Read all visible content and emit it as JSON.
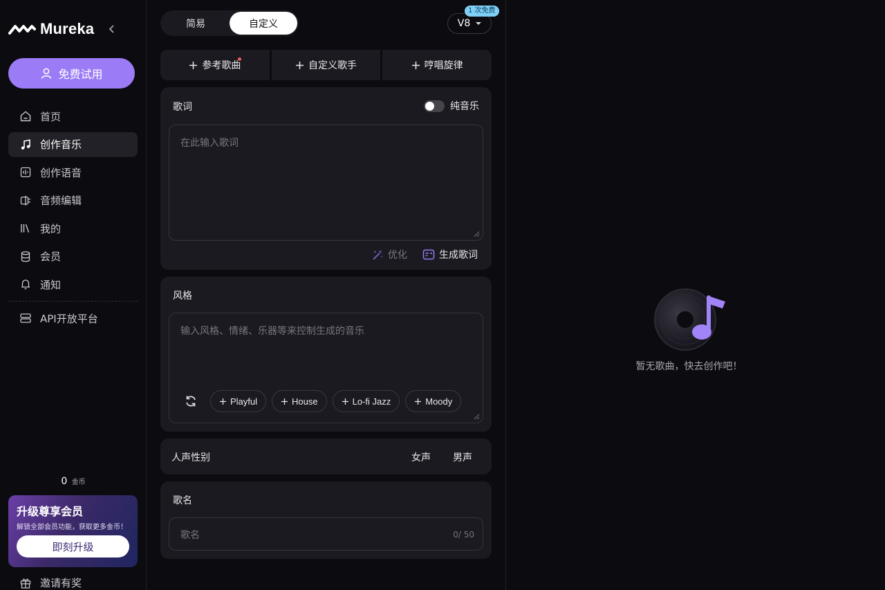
{
  "app": {
    "name": "Mureka"
  },
  "sidebar": {
    "trial_label": "免费试用",
    "items": [
      {
        "label": "首页",
        "icon": "home-icon",
        "active": false
      },
      {
        "label": "创作音乐",
        "icon": "music-note-icon",
        "active": true
      },
      {
        "label": "创作语音",
        "icon": "voice-icon",
        "active": false
      },
      {
        "label": "音频编辑",
        "icon": "audio-edit-icon",
        "active": false
      },
      {
        "label": "我的",
        "icon": "library-icon",
        "active": false
      },
      {
        "label": "会员",
        "icon": "database-icon",
        "active": false
      },
      {
        "label": "通知",
        "icon": "bell-icon",
        "active": false
      }
    ],
    "api_label": "API开放平台",
    "coins_value": "0",
    "coins_unit": "金币",
    "upgrade": {
      "title": "升级尊享会员",
      "subtitle": "解锁全部会员功能，获取更多金币！",
      "button": "即刻升级"
    },
    "invite_label": "邀请有奖"
  },
  "form": {
    "modes": [
      "简易",
      "自定义"
    ],
    "active_mode": "自定义",
    "version": "V8",
    "free_badge": "1 次免费",
    "add_buttons": [
      "参考歌曲",
      "自定义歌手",
      "哼唱旋律"
    ],
    "lyrics": {
      "label": "歌词",
      "instrumental_label": "纯音乐",
      "instrumental_on": false,
      "placeholder": "在此输入歌词",
      "optimize_label": "优化",
      "generate_label": "生成歌词"
    },
    "style": {
      "label": "风格",
      "placeholder": "输入风格、情绪、乐器等来控制生成的音乐",
      "tags": [
        "Playful",
        "House",
        "Lo-fi Jazz",
        "Moody"
      ]
    },
    "vocal": {
      "label": "人声性别",
      "female": "女声",
      "male": "男声"
    },
    "title": {
      "label": "歌名",
      "placeholder": "歌名",
      "counter": "0/ 50"
    }
  },
  "empty_state": {
    "text": "暂无歌曲，快去创作吧！"
  },
  "colors": {
    "accent": "#9b7cf6",
    "badge": "#7fd0f4",
    "dot": "#f25c5c"
  }
}
